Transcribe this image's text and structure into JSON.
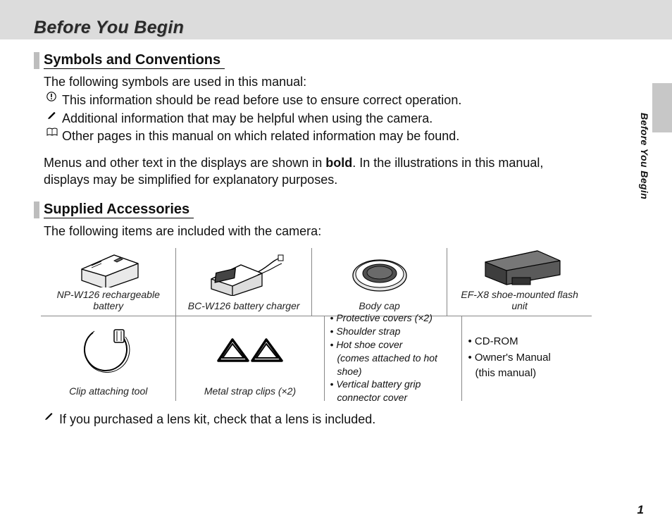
{
  "page": {
    "title": "Before You Begin",
    "side_tab": "Before You Begin",
    "number": "1"
  },
  "sect1": {
    "heading": "Symbols and Conventions",
    "intro": "The following symbols are used in this manual:",
    "sym_caution": "This information should be read before use to ensure correct operation.",
    "sym_tip": "Additional information that may be helpful when using the camera.",
    "sym_ref": "Other pages in this manual on which related information may be found.",
    "note_pre": "Menus and other text in the displays are shown in ",
    "note_bold": "bold",
    "note_post": ".  In the illustrations in this manual, displays may be simplified for explanatory purposes."
  },
  "sect2": {
    "heading": "Supplied Accessories",
    "intro": "The following items are included with the camera:",
    "items": {
      "battery": "NP-W126 rechargeable battery",
      "charger": "BC-W126 battery charger",
      "bodycap": "Body cap",
      "flash": "EF-X8 shoe-mounted flash unit",
      "cliptool": "Clip attaching tool",
      "clips": "Metal strap clips (×2)"
    },
    "list_a": {
      "i1": "Protective covers (×2)",
      "i2": "Shoulder strap",
      "i3": "Hot shoe cover",
      "i3s": "(comes attached to hot shoe)",
      "i4": "Vertical battery grip",
      "i4s": "connector cover"
    },
    "list_b": {
      "i1": "CD-ROM",
      "i2": "Owner's Manual",
      "i2s": "(this manual)"
    },
    "footnote": "If you purchased a lens kit, check that a lens is included."
  }
}
